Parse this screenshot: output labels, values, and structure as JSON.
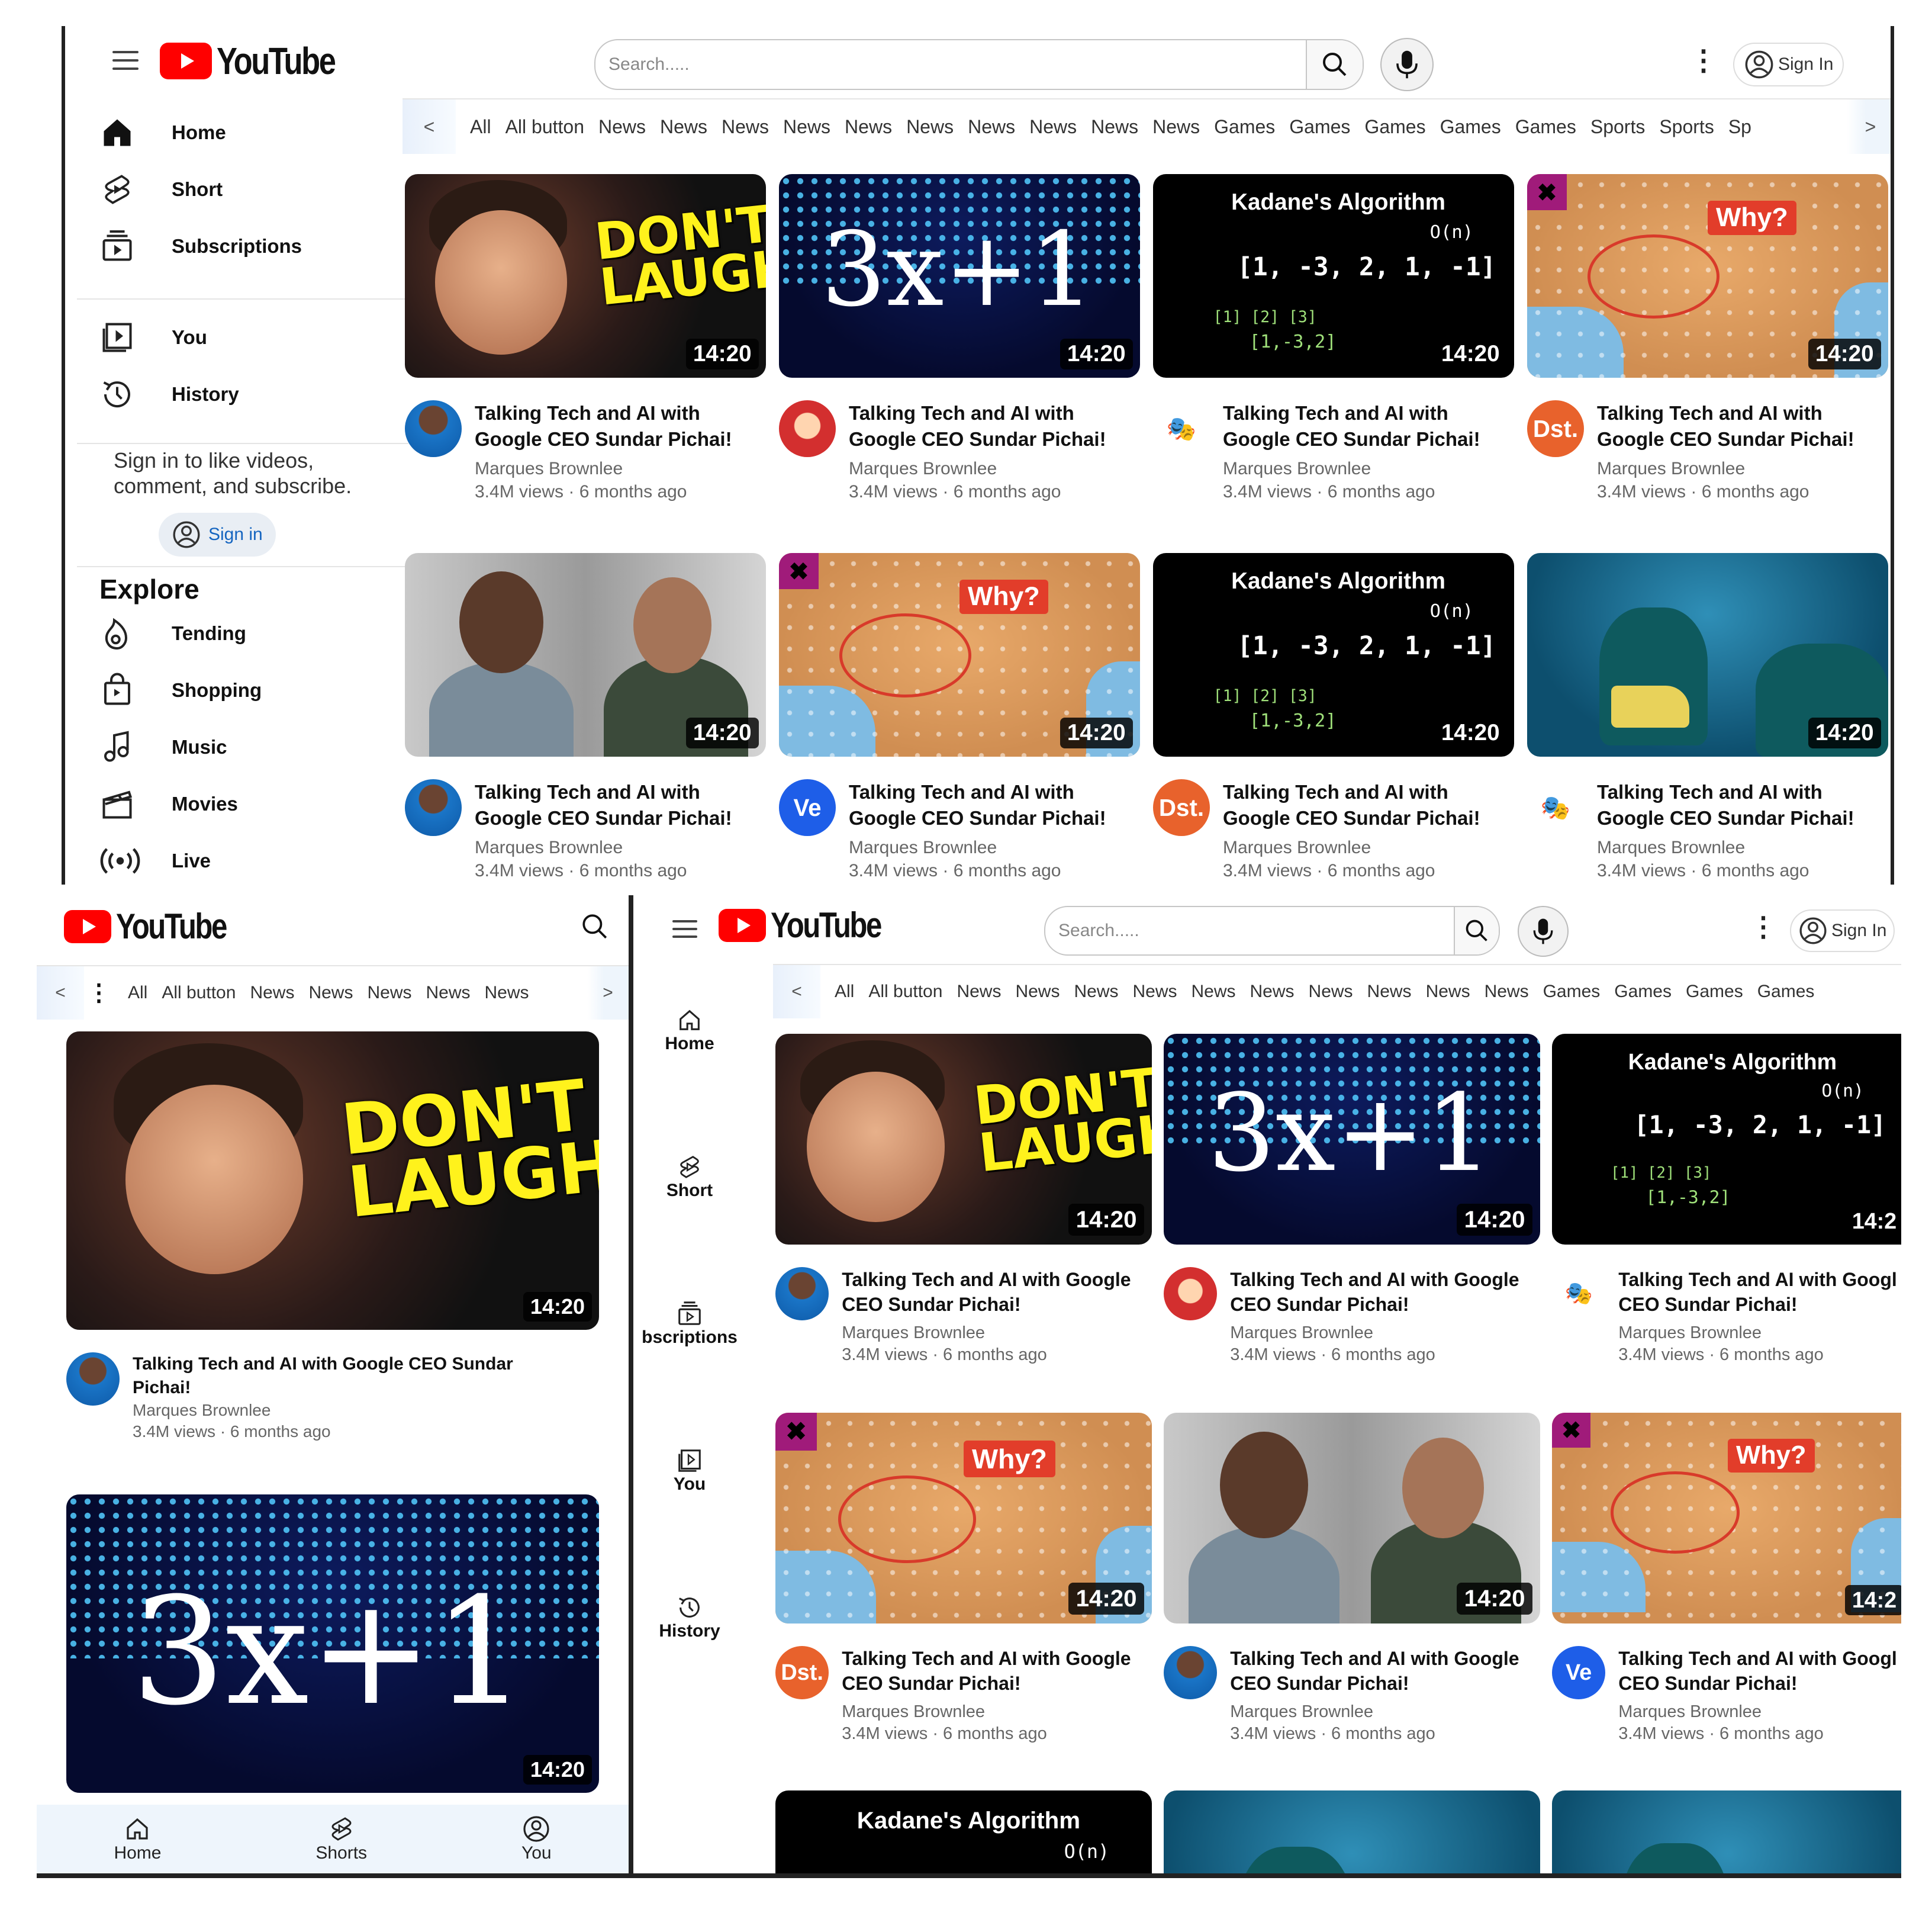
{
  "brand": {
    "name": "YouTube",
    "accent": "#ff0000"
  },
  "header": {
    "search_placeholder": "Search.....",
    "sign_in": "Sign In",
    "more": "⋮"
  },
  "chips": [
    "All",
    "All button",
    "News",
    "News",
    "News",
    "News",
    "News",
    "News",
    "News",
    "News",
    "News",
    "News",
    "Games",
    "Games",
    "Games",
    "Games",
    "Games",
    "Sports",
    "Sports",
    "Sp"
  ],
  "chips_small": [
    "All",
    "All button",
    "News",
    "News",
    "News",
    "News",
    "News"
  ],
  "chips_right": [
    "All",
    "All button",
    "News",
    "News",
    "News",
    "News",
    "News",
    "News",
    "News",
    "News",
    "News",
    "News",
    "Games",
    "Games",
    "Games",
    "Games"
  ],
  "chip_prev": "<",
  "chip_next": ">",
  "sidebar": {
    "main": [
      {
        "label": "Home",
        "icon": "home-icon"
      },
      {
        "label": "Short",
        "icon": "shorts-icon"
      },
      {
        "label": "Subscriptions",
        "icon": "subscriptions-icon"
      }
    ],
    "you": [
      {
        "label": "You",
        "icon": "you-icon"
      },
      {
        "label": "History",
        "icon": "history-icon"
      }
    ],
    "signin_prompt": "Sign in to like videos, comment, and subscribe.",
    "signin_button": "Sign in",
    "explore_title": "Explore",
    "explore": [
      {
        "label": "Tending",
        "icon": "trending-icon"
      },
      {
        "label": "Shopping",
        "icon": "shopping-icon"
      },
      {
        "label": "Music",
        "icon": "music-icon"
      },
      {
        "label": "Movies",
        "icon": "movies-icon"
      },
      {
        "label": "Live",
        "icon": "live-icon"
      }
    ]
  },
  "mini_sidebar": [
    "Home",
    "Short",
    "bscriptions",
    "You",
    "History"
  ],
  "bottom_nav": [
    "Home",
    "Shorts",
    "You"
  ],
  "video": {
    "title": "Talking Tech and AI with Google CEO Sundar Pichai!",
    "title_l1": "Talking Tech and AI with",
    "title_l2": "Google CEO Sundar Pichai!",
    "title_m1": "Talking Tech and AI with Google",
    "title_m2": "CEO Sundar Pichai!",
    "title_m1_cut": "Talking Tech and AI with Googl",
    "title_s1": "Talking Tech and AI with Google CEO Sundar",
    "title_s2": "Pichai!",
    "channel": "Marques Brownlee",
    "stats": "3.4M views · 6 months ago",
    "duration": "14:20",
    "duration_cut": "14:2"
  },
  "thumb_text": {
    "dont": "DON'T",
    "laugh": "LAUGH",
    "collatz": "3x+1",
    "kadane_title": "Kadane's Algorithm",
    "kadane_big_o": "O(n)",
    "kadane_array": "[1, -3, 2, 1, -1]",
    "kadane_sub1": "[1]        [2] [3]",
    "kadane_sub2": "[1,-3,2]",
    "why": "Why?",
    "ve": "Ve",
    "dst": "Dst."
  }
}
